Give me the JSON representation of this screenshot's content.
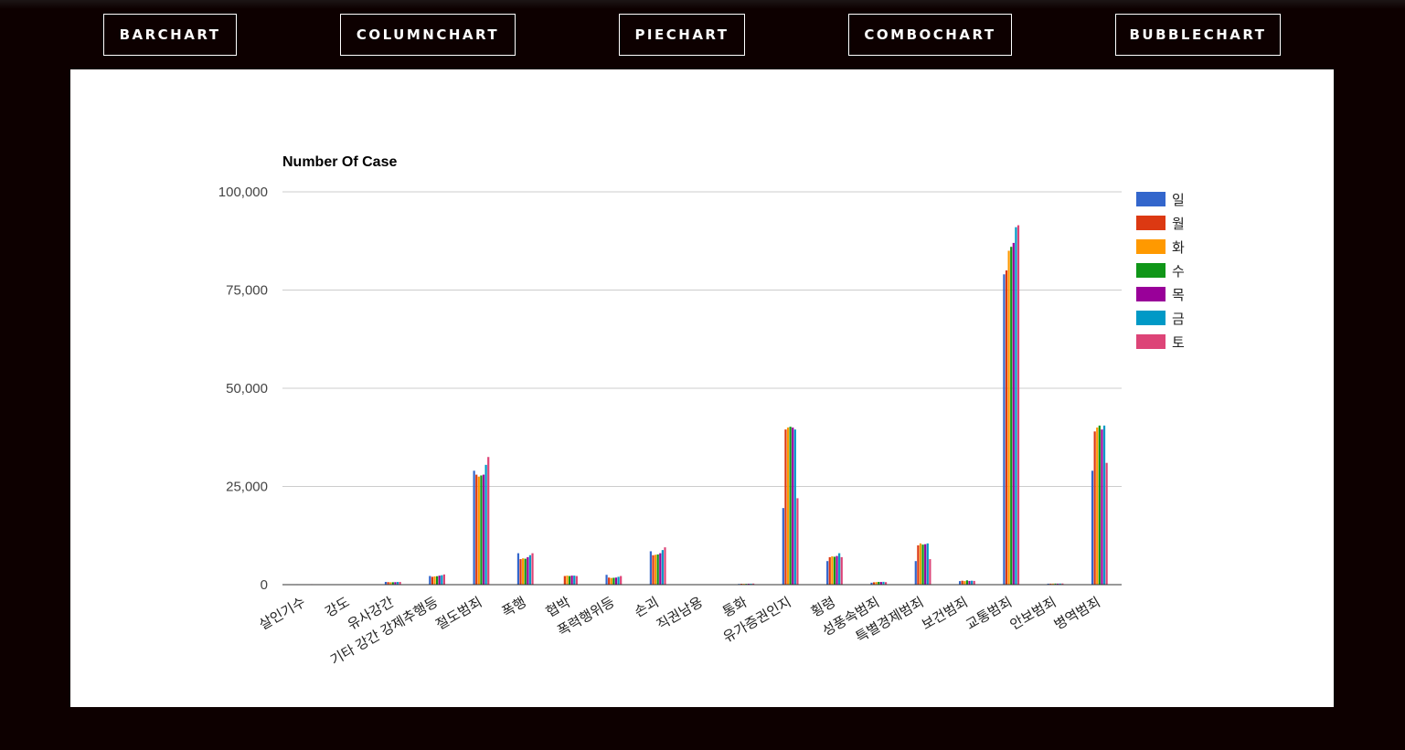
{
  "nav": {
    "items": [
      {
        "label": "BARCHART"
      },
      {
        "label": "COLUMNCHART"
      },
      {
        "label": "PIECHART"
      },
      {
        "label": "COMBOCHART"
      },
      {
        "label": "BUBBLECHART"
      }
    ]
  },
  "chart_data": {
    "type": "bar",
    "title": "Number Of Case",
    "ylabel": "",
    "xlabel": "",
    "ylim": [
      0,
      100000
    ],
    "yticks": [
      "0",
      "25,000",
      "50,000",
      "75,000",
      "100,000"
    ],
    "grid": true,
    "legend_position": "right",
    "categories": [
      "살인기수",
      "강도",
      "유사강간",
      "기타 강간 강제추행등",
      "절도범죄",
      "폭행",
      "협박",
      "폭력행위등",
      "손괴",
      "직권남용",
      "통화",
      "유가증권인지",
      "횡령",
      "성풍속범죄",
      "특별경제범죄",
      "보건범죄",
      "교통범죄",
      "안보범죄",
      "병역범죄"
    ],
    "series": [
      {
        "name": "일",
        "color": "#3366cc",
        "values": [
          120,
          80,
          700,
          2200,
          29000,
          8000,
          60,
          2500,
          8500,
          20,
          200,
          19500,
          6000,
          500,
          6000,
          900,
          79000,
          250,
          29000
        ]
      },
      {
        "name": "월",
        "color": "#dc3912",
        "values": [
          110,
          70,
          650,
          2000,
          28000,
          6500,
          2200,
          1800,
          7500,
          25,
          230,
          39500,
          7000,
          600,
          10000,
          1000,
          80000,
          260,
          39000
        ]
      },
      {
        "name": "화",
        "color": "#ff9900",
        "values": [
          100,
          75,
          600,
          2100,
          27500,
          6700,
          2300,
          1700,
          7600,
          22,
          220,
          40000,
          7200,
          650,
          10500,
          900,
          85000,
          270,
          40000
        ]
      },
      {
        "name": "수",
        "color": "#109618",
        "values": [
          105,
          72,
          620,
          2150,
          27800,
          6600,
          2200,
          1750,
          7700,
          21,
          210,
          40200,
          7100,
          700,
          10200,
          1100,
          86000,
          280,
          40500
        ]
      },
      {
        "name": "목",
        "color": "#990099",
        "values": [
          108,
          74,
          640,
          2300,
          28000,
          7000,
          2300,
          1800,
          8000,
          23,
          240,
          40000,
          7300,
          680,
          10300,
          950,
          87000,
          265,
          39500
        ]
      },
      {
        "name": "금",
        "color": "#0099c6",
        "values": [
          115,
          78,
          680,
          2400,
          30500,
          7500,
          2300,
          2000,
          8800,
          24,
          260,
          39500,
          8000,
          720,
          10500,
          1000,
          91000,
          290,
          40500
        ]
      },
      {
        "name": "토",
        "color": "#dd4477",
        "values": [
          125,
          85,
          700,
          2600,
          32500,
          8000,
          2200,
          2200,
          9500,
          26,
          280,
          22000,
          7000,
          640,
          6500,
          950,
          91500,
          300,
          31000
        ]
      }
    ]
  }
}
